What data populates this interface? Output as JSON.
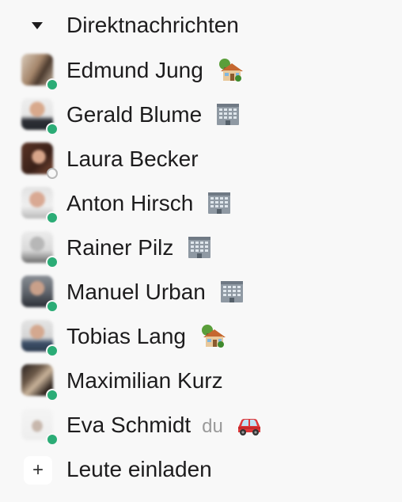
{
  "section": {
    "title": "Direktnachrichten",
    "caret_icon": "caret-down-icon"
  },
  "contacts": [
    {
      "name": "Edmund Jung",
      "status_icon": "house-with-garden-icon",
      "presence": "active",
      "suffix": ""
    },
    {
      "name": "Gerald Blume",
      "status_icon": "office-building-icon",
      "presence": "active",
      "suffix": ""
    },
    {
      "name": "Laura Becker",
      "status_icon": "",
      "presence": "away",
      "suffix": ""
    },
    {
      "name": "Anton Hirsch",
      "status_icon": "office-building-icon",
      "presence": "active",
      "suffix": ""
    },
    {
      "name": "Rainer Pilz",
      "status_icon": "office-building-icon",
      "presence": "active",
      "suffix": ""
    },
    {
      "name": "Manuel Urban",
      "status_icon": "office-building-icon",
      "presence": "active",
      "suffix": ""
    },
    {
      "name": "Tobias Lang",
      "status_icon": "house-with-garden-icon",
      "presence": "active",
      "suffix": ""
    },
    {
      "name": "Maximilian Kurz",
      "status_icon": "",
      "presence": "active",
      "suffix": ""
    },
    {
      "name": "Eva Schmidt",
      "status_icon": "car-icon",
      "presence": "active",
      "suffix": "du"
    }
  ],
  "invite": {
    "label": "Leute einladen",
    "icon": "plus-icon",
    "symbol": "+"
  },
  "colors": {
    "background": "#f8f8f8",
    "presence_active": "#2bac76",
    "text": "#1d1c1d",
    "muted": "#9a9a9a"
  }
}
